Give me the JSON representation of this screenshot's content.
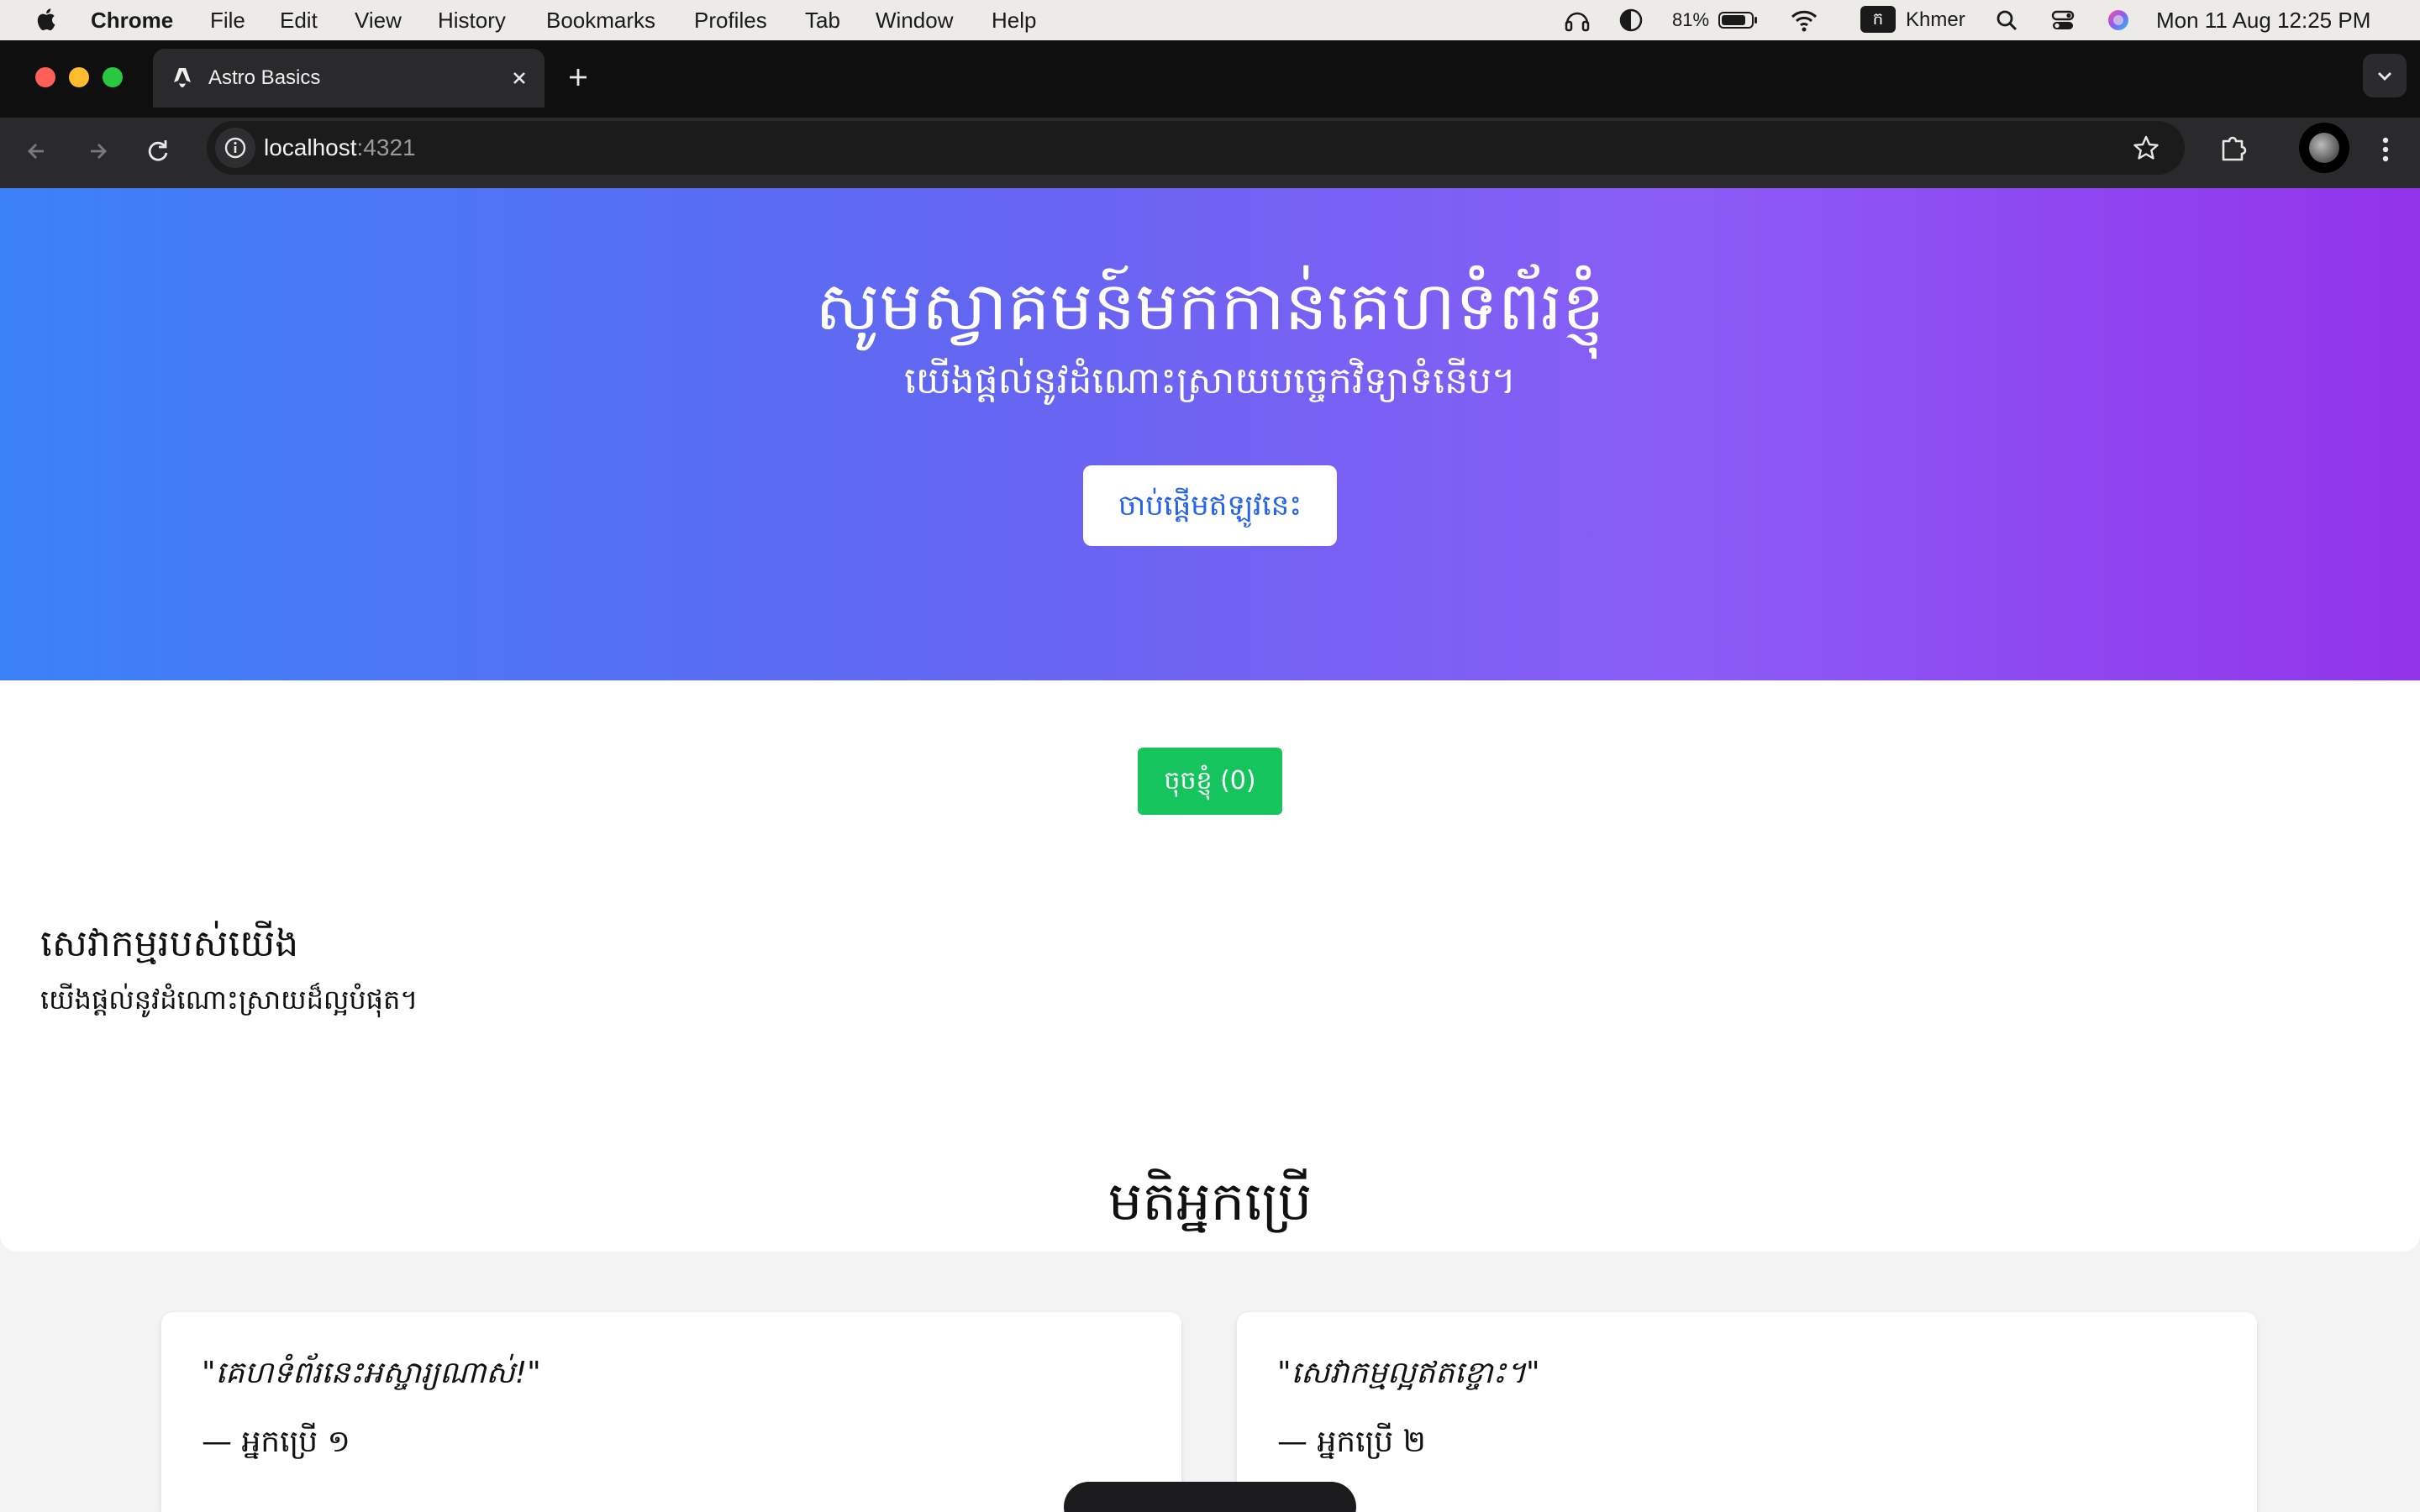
{
  "menubar": {
    "app": "Chrome",
    "items": [
      "File",
      "Edit",
      "View",
      "History",
      "Bookmarks",
      "Profiles",
      "Tab",
      "Window",
      "Help"
    ],
    "battery": "81%",
    "input_source_badge": "ក",
    "input_source": "Khmer",
    "datetime": "Mon 11 Aug  12:25 PM"
  },
  "browser": {
    "tab_title": "Astro Basics",
    "url_host": "localhost",
    "url_port": ":4321"
  },
  "hero": {
    "title": "សូមស្វាគមន៍មកកាន់គេហទំព័រខ្ញុំ",
    "subtitle": "យើងផ្តល់នូវដំណោះស្រាយបច្ចេកវិទ្យាទំនើប។",
    "cta": "ចាប់ផ្តើមឥឡូវនេះ"
  },
  "counter": {
    "label": "ចុចខ្ញុំ (0)"
  },
  "services": {
    "title": "សេវាកម្មរបស់យើង",
    "text": "យើងផ្តល់នូវដំណោះស្រាយដ៏ល្អបំផុត។"
  },
  "testimonials": {
    "title": "មតិអ្នកប្រើ",
    "items": [
      {
        "quote": "\"គេហទំព័រនេះអស្ចារ្យណាស់!\"",
        "author": "— អ្នកប្រើ ១"
      },
      {
        "quote": "\"សេវាកម្មល្អឥតខ្ចោះ។\"",
        "author": "— អ្នកប្រើ ២"
      }
    ]
  },
  "colors": {
    "hero_gradient": [
      "#3b82f6",
      "#6366f1",
      "#8b5cf6",
      "#9333ea"
    ],
    "cta_text": "#2563eb",
    "counter_bg": "#16c45d"
  }
}
